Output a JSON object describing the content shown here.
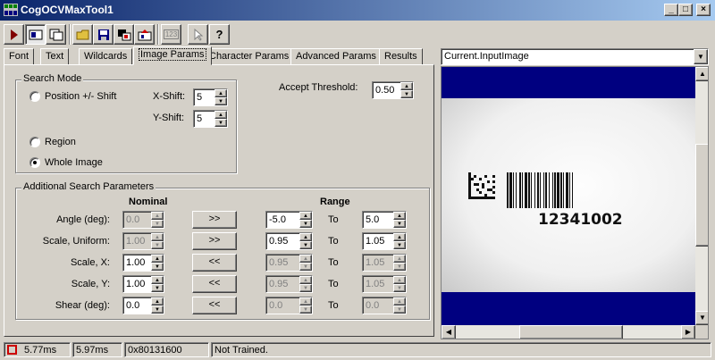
{
  "window": {
    "title": "CogOCVMaxTool1"
  },
  "toolbar": {
    "icons": [
      "run-icon",
      "show-image-icon",
      "show-input-icon",
      "open-icon",
      "save-icon",
      "image-source-icon",
      "train-icon",
      "numeric-icon",
      "cursor-icon",
      "help-icon"
    ],
    "numeric_label": "123"
  },
  "tabs": [
    "Font",
    "Text",
    "Wildcards",
    "Image Params",
    "Character Params",
    "Advanced Params",
    "Results"
  ],
  "active_tab": "Image Params",
  "search_mode": {
    "title": "Search Mode",
    "options": [
      "Position +/- Shift",
      "Region",
      "Whole Image"
    ],
    "selected": "Whole Image",
    "x_shift_label": "X-Shift:",
    "x_shift": "5",
    "y_shift_label": "Y-Shift:",
    "y_shift": "5"
  },
  "accept": {
    "label": "Accept Threshold:",
    "value": "0.50"
  },
  "additional": {
    "title": "Additional Search Parameters",
    "nominal_header": "Nominal",
    "range_header": "Range",
    "to_label": "To",
    "rows": [
      {
        "label": "Angle (deg):",
        "nominal": "0.0",
        "button": ">>",
        "low": "-5.0",
        "high": "5.0"
      },
      {
        "label": "Scale, Uniform:",
        "nominal": "1.00",
        "button": ">>",
        "low": "0.95",
        "high": "1.05"
      },
      {
        "label": "Scale, X:",
        "nominal": "1.00",
        "button": "<<",
        "low": "0.95",
        "high": "1.05"
      },
      {
        "label": "Scale, Y:",
        "nominal": "1.00",
        "button": "<<",
        "low": "0.95",
        "high": "1.05"
      },
      {
        "label": "Shear (deg):",
        "nominal": "0.0",
        "button": "<<",
        "low": "0.0",
        "high": "0.0"
      }
    ]
  },
  "image_view": {
    "selector": "Current.InputImage",
    "barcode_text": "12341002"
  },
  "status": {
    "time1": "5.77ms",
    "time2": "5.97ms",
    "address": "0x80131600",
    "message": "Not Trained."
  },
  "colors": {
    "title_start": "#0a246a",
    "title_end": "#a6caf0",
    "image_band": "#000080",
    "status_error": "#cc0000"
  }
}
